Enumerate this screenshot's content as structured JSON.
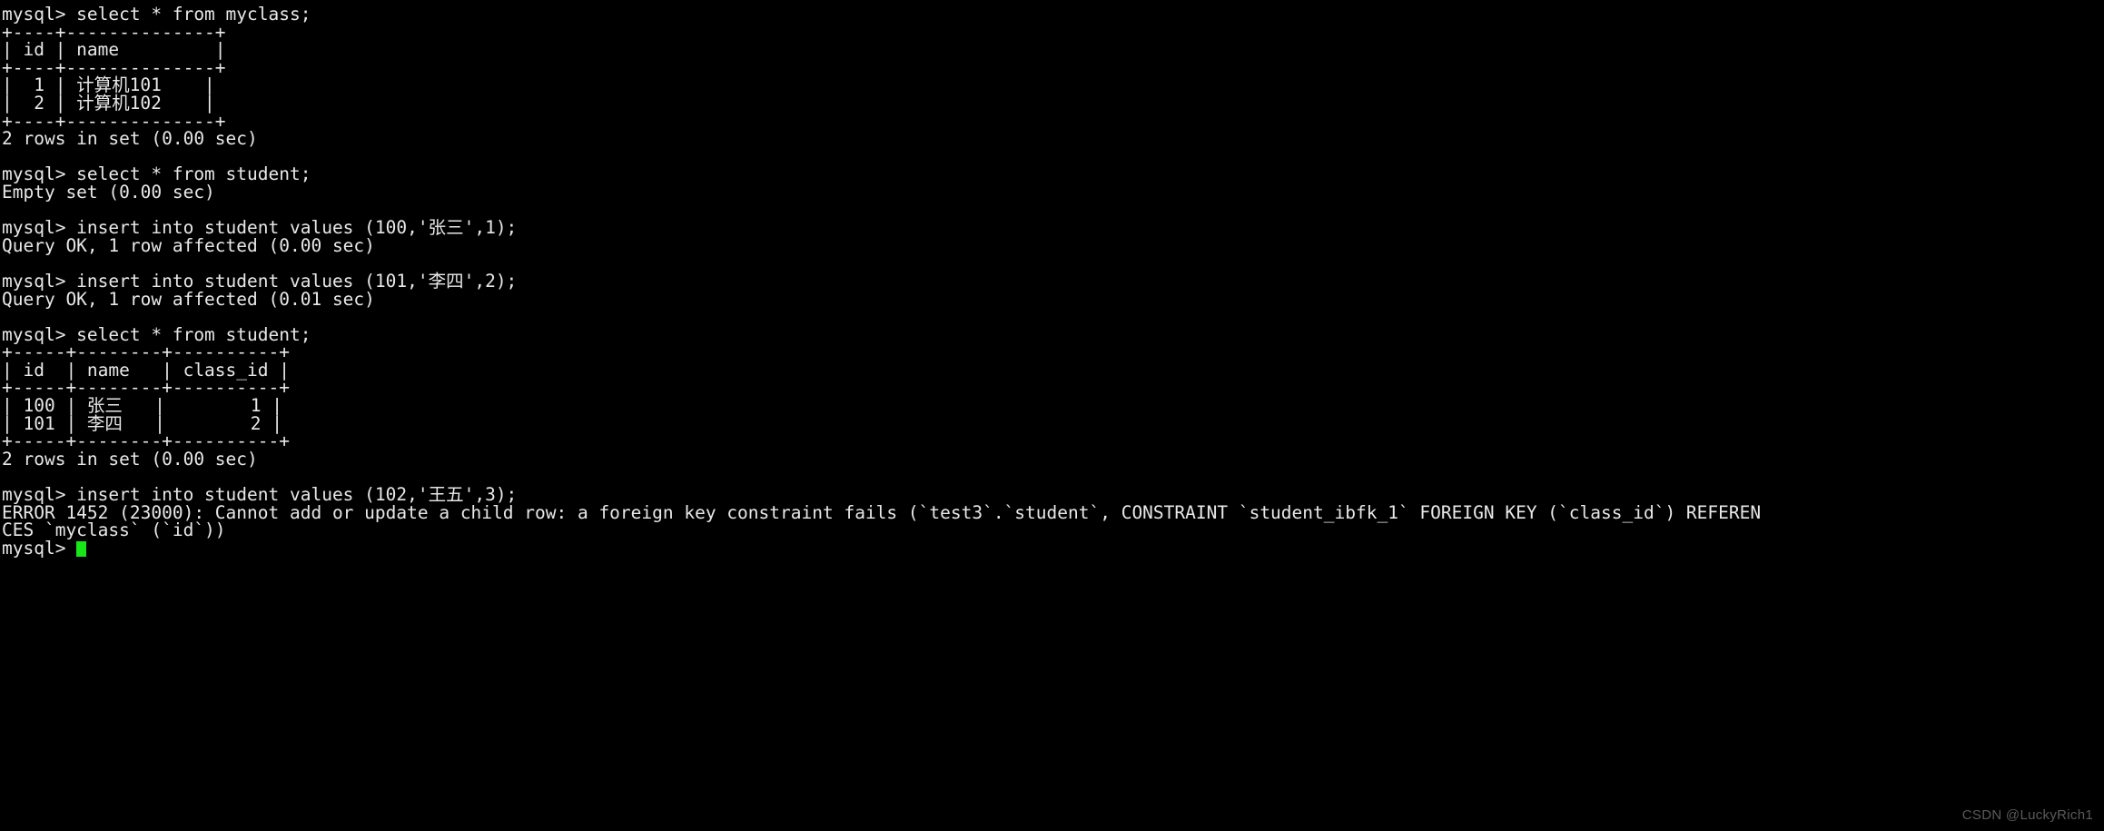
{
  "terminal": {
    "app": "mysql-client-terminal",
    "prompt": "mysql> ",
    "background_color": "#000000",
    "foreground_color": "#e8e8e8",
    "cursor_color": "#19e619",
    "lines": [
      "mysql> select * from myclass;",
      "+----+--------------+",
      "| id | name         |",
      "+----+--------------+",
      "|  1 | 计算机101    |",
      "|  2 | 计算机102    |",
      "+----+--------------+",
      "2 rows in set (0.00 sec)",
      "",
      "mysql> select * from student;",
      "Empty set (0.00 sec)",
      "",
      "mysql> insert into student values (100,'张三',1);",
      "Query OK, 1 row affected (0.00 sec)",
      "",
      "mysql> insert into student values (101,'李四',2);",
      "Query OK, 1 row affected (0.01 sec)",
      "",
      "mysql> select * from student;",
      "+-----+--------+----------+",
      "| id  | name   | class_id |",
      "+-----+--------+----------+",
      "| 100 | 张三   |        1 |",
      "| 101 | 李四   |        2 |",
      "+-----+--------+----------+",
      "2 rows in set (0.00 sec)",
      "",
      "mysql> insert into student values (102,'王五',3);",
      "ERROR 1452 (23000): Cannot add or update a child row: a foreign key constraint fails (`test3`.`student`, CONSTRAINT `student_ibfk_1` FOREIGN KEY (`class_id`) REFEREN",
      "CES `myclass` (`id`))"
    ],
    "final_prompt": "mysql> ",
    "watermark": "CSDN @LuckyRich1"
  }
}
